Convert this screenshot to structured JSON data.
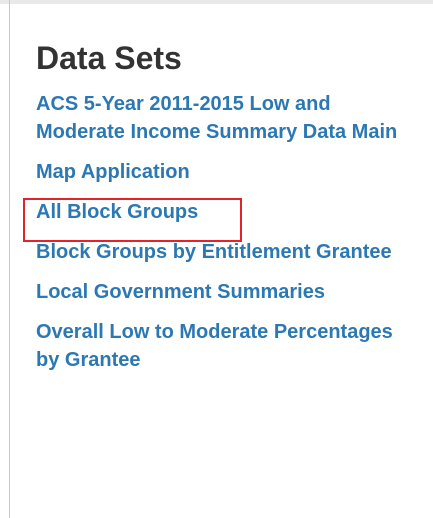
{
  "sidebar": {
    "heading": "Data Sets",
    "links": [
      {
        "label": "ACS 5-Year 2011-2015 Low and Moderate Income Summary Data Main"
      },
      {
        "label": "Map Application"
      },
      {
        "label": "All Block Groups"
      },
      {
        "label": "Block Groups by Entitlement Grantee"
      },
      {
        "label": "Local Government Summaries"
      },
      {
        "label": "Overall Low to Moderate Percentages by Grantee"
      }
    ]
  },
  "colors": {
    "heading": "#333333",
    "link": "#2c78b3",
    "highlight": "#e2232a"
  }
}
